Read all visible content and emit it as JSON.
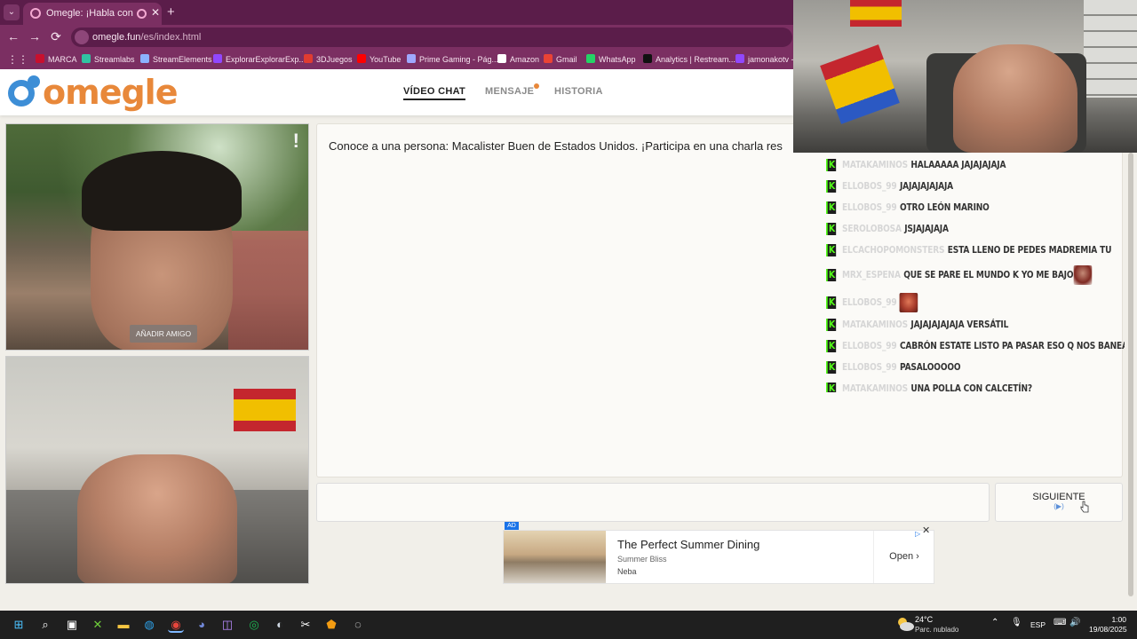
{
  "browser": {
    "tab_title": "Omegle: ¡Habla con Desco",
    "tab_close": "✕",
    "new_tab": "+",
    "url_host": "omegle.fun",
    "url_path": "/es/index.html",
    "back": "←",
    "forward": "→",
    "reload": "⟳",
    "bookmarks": [
      {
        "label": "MARCA",
        "color": "#c8102e"
      },
      {
        "label": "Streamlabs",
        "color": "#31c3a2"
      },
      {
        "label": "StreamElements",
        "color": "#8bb2ff"
      },
      {
        "label": "ExplorarExplorarExp...",
        "color": "#9147ff"
      },
      {
        "label": "3DJuegos",
        "color": "#e03c31"
      },
      {
        "label": "YouTube",
        "color": "#ff0000"
      },
      {
        "label": "Prime Gaming - Pág...",
        "color": "#9fa8ff"
      },
      {
        "label": "Amazon",
        "color": "#ffffff"
      },
      {
        "label": "Gmail",
        "color": "#ea4335"
      },
      {
        "label": "WhatsApp",
        "color": "#25d366"
      },
      {
        "label": "Analytics | Restream...",
        "color": "#111111"
      },
      {
        "label": "jamonakotv - T",
        "color": "#9147ff"
      }
    ]
  },
  "site": {
    "logo": "omegle",
    "nav": [
      {
        "label": "VÍDEO CHAT",
        "active": true
      },
      {
        "label": "MENSAJE",
        "active": false,
        "dot": true
      },
      {
        "label": "HISTORIA",
        "active": false
      }
    ],
    "stranger": {
      "add_friend": "AÑADIR AMIGO",
      "report": "!"
    },
    "chat_intro": "Conoce a una persona: Macalister Buen de Estados Unidos. ¡Participa en una charla res",
    "next_button": {
      "label": "SIGUIENTE",
      "hint": "(▶)"
    },
    "ad": {
      "badge": "AD",
      "title": "The Perfect Summer Dining",
      "subtitle": "Summer Bliss",
      "brand": "Neba",
      "cta": "Open",
      "close": "✕",
      "choices": "▷"
    }
  },
  "overlay_chat": [
    {
      "user": "MATAKAMINOS",
      "text": "HALAAAAA JAJAJAJAJA",
      "emote": ""
    },
    {
      "user": "ELLOBOS_99",
      "text": "JAJAJAJAJAJA",
      "emote": ""
    },
    {
      "user": "ELLOBOS_99",
      "text": "OTRO LEÓN MARINO",
      "emote": ""
    },
    {
      "user": "SEROLOBOSA",
      "text": "JSJAJAJAJA",
      "emote": ""
    },
    {
      "user": "ELCACHOPOMONSTERS",
      "text": "ESTA LLENO DE PEDES MADREMIA TU",
      "emote": ""
    },
    {
      "user": "MRX_ESPENA",
      "text": "QUE SE PARE EL MUNDO K YO ME BAJO",
      "emote": "rose"
    },
    {
      "user": "ELLOBOS_99",
      "text": "",
      "emote": "face"
    },
    {
      "user": "MATAKAMINOS",
      "text": "JAJAJAJAJAJA VERSÁTIL",
      "emote": ""
    },
    {
      "user": "ELLOBOS_99",
      "text": "CABRÓN ESTATE LISTO PA PASAR ESO Q NOS BANEAN",
      "emote": ""
    },
    {
      "user": "ELLOBOS_99",
      "text": "PASALOOOOO",
      "emote": ""
    },
    {
      "user": "MATAKAMINOS",
      "text": "UNA POLLA CON CALCETÍN?",
      "emote": ""
    }
  ],
  "taskbar": {
    "icons": [
      {
        "name": "windows-start-icon",
        "glyph": "⊞",
        "color": "#4cc2ff"
      },
      {
        "name": "search-icon",
        "glyph": "⌕",
        "color": "#ffffff"
      },
      {
        "name": "task-view-icon",
        "glyph": "▣",
        "color": "#ffffff"
      },
      {
        "name": "xbox-icon",
        "glyph": "✕",
        "color": "#6fcf3a"
      },
      {
        "name": "file-explorer-icon",
        "glyph": "▬",
        "color": "#f5c542"
      },
      {
        "name": "edge-icon",
        "glyph": "◍",
        "color": "#2ea0e6"
      },
      {
        "name": "chrome-icon",
        "glyph": "◉",
        "color": "#e8453c"
      },
      {
        "name": "discord-icon",
        "glyph": "◕",
        "color": "#7289da"
      },
      {
        "name": "twitch-icon",
        "glyph": "◫",
        "color": "#b98cff"
      },
      {
        "name": "spotify-icon",
        "glyph": "◎",
        "color": "#1db954"
      },
      {
        "name": "steam-icon",
        "glyph": "◐",
        "color": "#cfd8e3"
      },
      {
        "name": "capcut-icon",
        "glyph": "✂",
        "color": "#ffffff"
      },
      {
        "name": "shield-app-icon",
        "glyph": "⬟",
        "color": "#f39c12"
      },
      {
        "name": "obs-icon",
        "glyph": "◌",
        "color": "#ffffff"
      }
    ],
    "temperature": "24°C",
    "condition": "Parc. nublado",
    "lang": "ESP",
    "time": "1:00",
    "date": "19/08/2025"
  }
}
